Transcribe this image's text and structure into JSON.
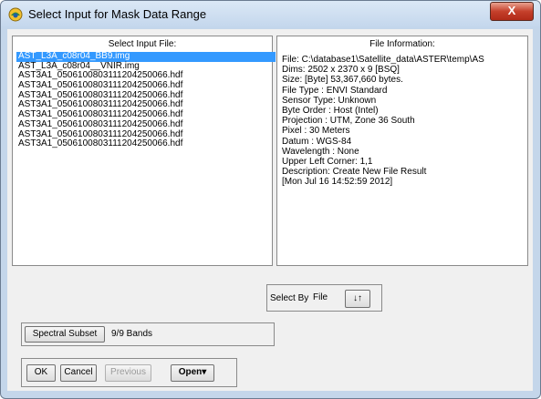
{
  "window": {
    "title": "Select Input for Mask Data Range",
    "close_glyph": "X"
  },
  "input_panel": {
    "heading": "Select Input File:",
    "files": [
      "AST_L3A_c08r04_BB9.img",
      "AST_L3A_c08r04__VNIR.img",
      "AST3A1_0506100803111204250066.hdf",
      "AST3A1_0506100803111204250066.hdf",
      "AST3A1_0506100803111204250066.hdf",
      "AST3A1_0506100803111204250066.hdf",
      "AST3A1_0506100803111204250066.hdf",
      "AST3A1_0506100803111204250066.hdf",
      "AST3A1_0506100803111204250066.hdf",
      "AST3A1_0506100803111204250066.hdf"
    ],
    "selected_index": 0
  },
  "info_panel": {
    "heading": "File Information:",
    "lines": [
      "File: C:\\database1\\Satellite_data\\ASTER\\temp\\AS",
      "Dims: 2502 x 2370 x 9 [BSQ]",
      "Size: [Byte] 53,367,660 bytes.",
      "File Type  : ENVI Standard",
      "Sensor Type: Unknown",
      "Byte Order : Host (Intel)",
      "Projection : UTM, Zone 36 South",
      "  Pixel    : 30 Meters",
      "  Datum    : WGS-84",
      "Wavelength : None",
      "Upper Left Corner: 1,1",
      "Description: Create New File Result",
      "[Mon Jul 16 14:52:59 2012]"
    ]
  },
  "select_by": {
    "label": "Select By",
    "value": "File",
    "sort_icon_glyph": "↓↑"
  },
  "spectral": {
    "button_label": "Spectral Subset",
    "bands_text": "9/9 Bands"
  },
  "buttons": {
    "ok": "OK",
    "cancel": "Cancel",
    "previous": "Previous",
    "open": "Open",
    "open_arrow": "▾"
  },
  "colors": {
    "selection": "#3399ff",
    "frame": "#c4d6ea",
    "close": "#c5402b"
  }
}
